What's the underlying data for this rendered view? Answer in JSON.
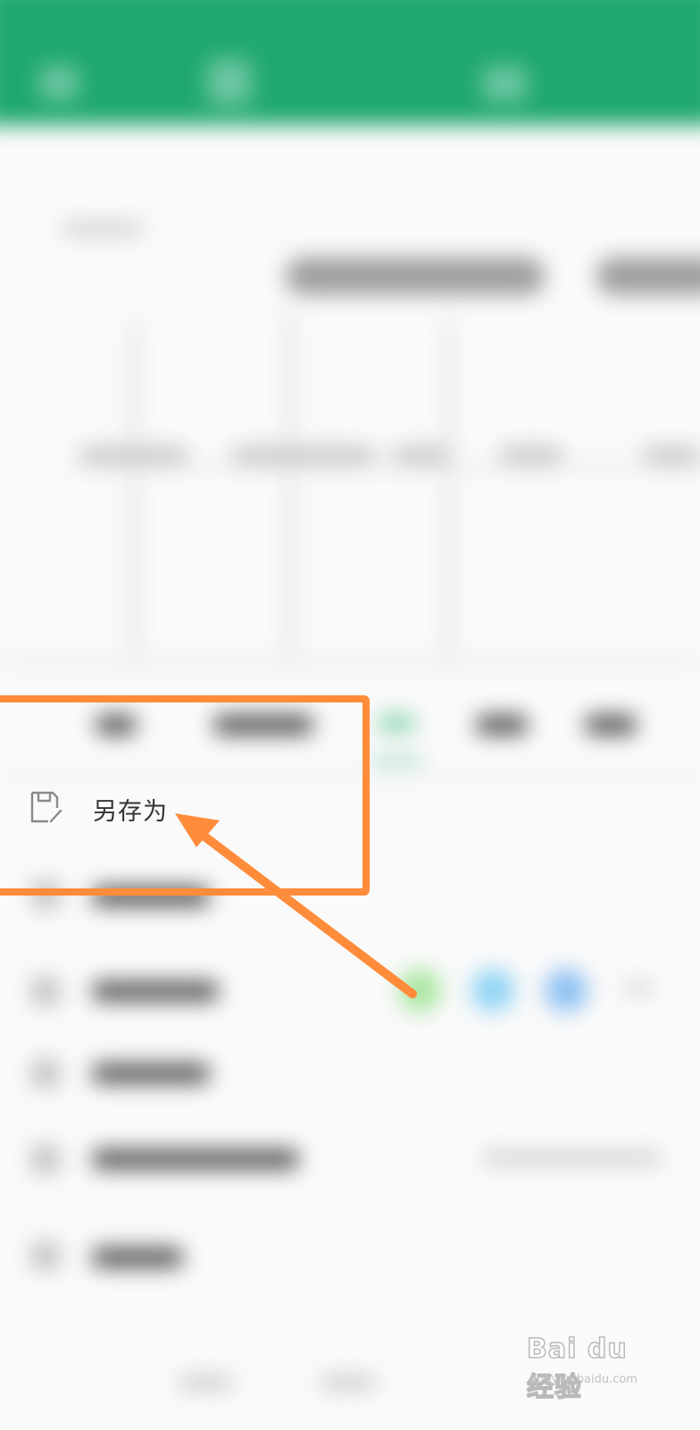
{
  "menu": {
    "save_as": {
      "label": "另存为",
      "icon": "save-as-icon"
    }
  },
  "annotation": {
    "highlight_color": "#ff8c3a"
  },
  "watermark": {
    "logo_text": "Bai du 经验",
    "url": "jingyan.baidu.com"
  },
  "colors": {
    "header": "#20a870",
    "dot_green": "#a8e6a0",
    "dot_blue_light": "#8fd3f5",
    "dot_blue": "#8cc0f2"
  }
}
